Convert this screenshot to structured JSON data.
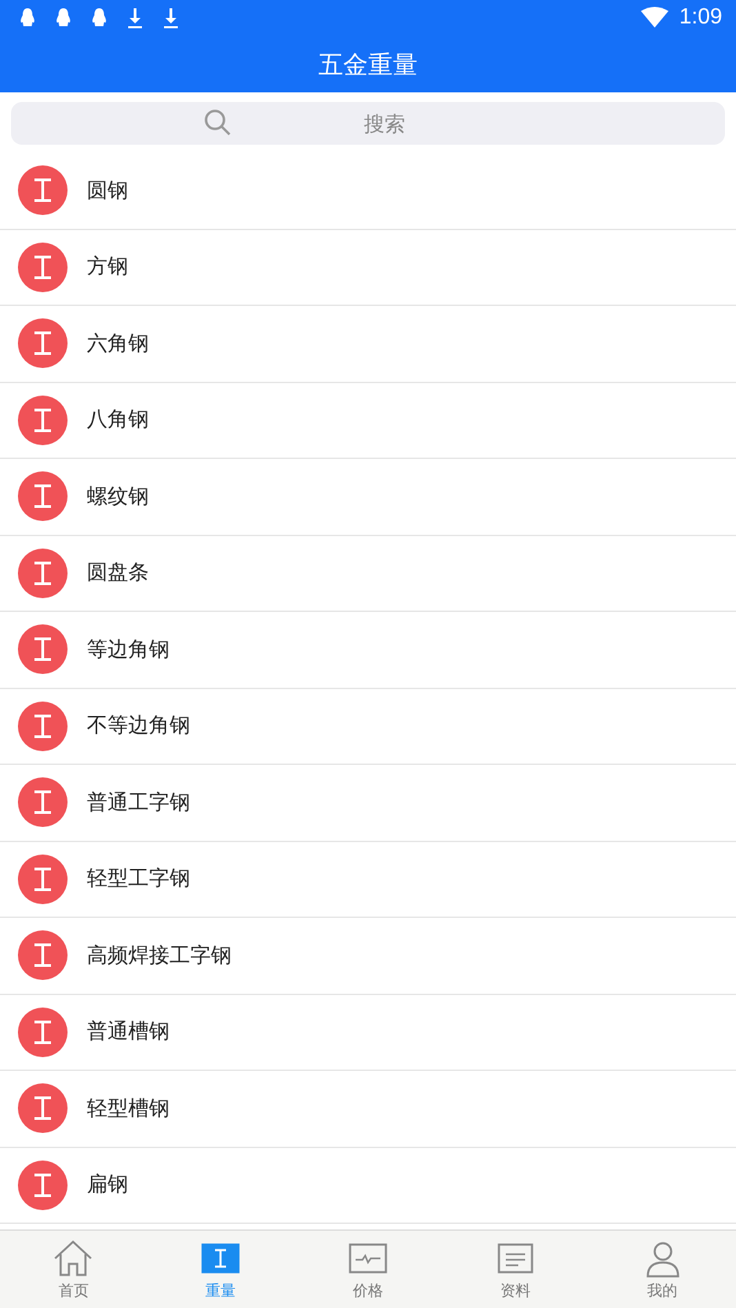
{
  "status_bar": {
    "time": "1:09"
  },
  "title": "五金重量",
  "search": {
    "placeholder": "搜索"
  },
  "items": [
    {
      "label": "圆钢"
    },
    {
      "label": "方钢"
    },
    {
      "label": "六角钢"
    },
    {
      "label": "八角钢"
    },
    {
      "label": "螺纹钢"
    },
    {
      "label": "圆盘条"
    },
    {
      "label": "等边角钢"
    },
    {
      "label": "不等边角钢"
    },
    {
      "label": "普通工字钢"
    },
    {
      "label": "轻型工字钢"
    },
    {
      "label": "高频焊接工字钢"
    },
    {
      "label": "普通槽钢"
    },
    {
      "label": "轻型槽钢"
    },
    {
      "label": "扁钢"
    }
  ],
  "tabs": [
    {
      "label": "首页",
      "kind": "home",
      "selected": false
    },
    {
      "label": "重量",
      "kind": "weight",
      "selected": true
    },
    {
      "label": "价格",
      "kind": "price",
      "selected": false
    },
    {
      "label": "资料",
      "kind": "docs",
      "selected": false
    },
    {
      "label": "我的",
      "kind": "me",
      "selected": false
    }
  ]
}
